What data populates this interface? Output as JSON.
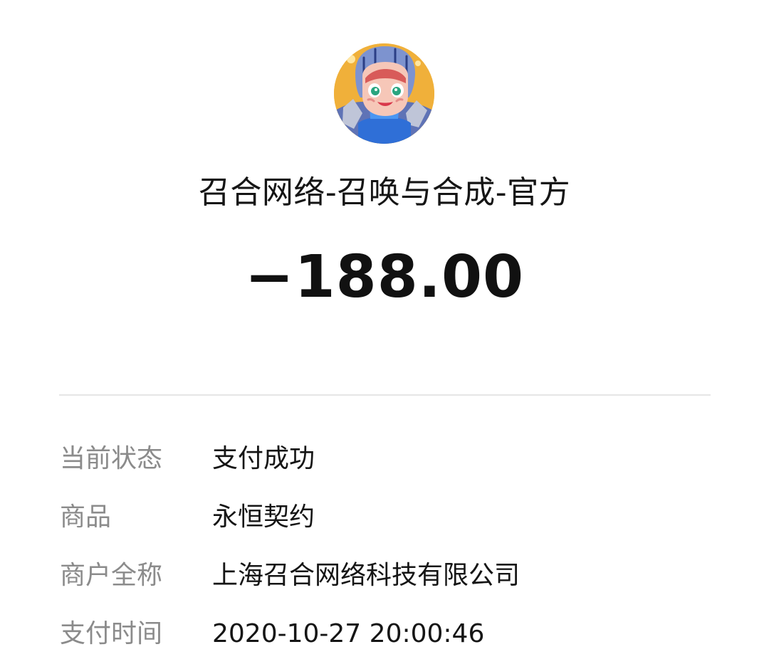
{
  "merchant": {
    "avatar_icon": "game-character-avatar",
    "name": "召合网络-召唤与合成-官方"
  },
  "transaction": {
    "amount": "−188.00"
  },
  "details": [
    {
      "label": "当前状态",
      "value": "支付成功"
    },
    {
      "label": "商品",
      "value": "永恒契约"
    },
    {
      "label": "商户全称",
      "value": "上海召合网络科技有限公司"
    },
    {
      "label": "支付时间",
      "value": "2020-10-27 20:00:46"
    }
  ]
}
